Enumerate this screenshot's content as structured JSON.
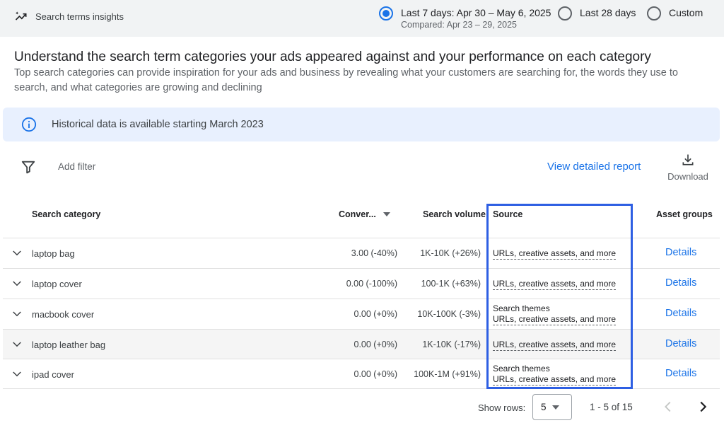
{
  "header": {
    "title": "Search terms insights",
    "icon": "trending-icon"
  },
  "date_range": {
    "options": [
      {
        "label": "Last 7 days: Apr 30 – May 6, 2025",
        "sub": "Compared: Apr 23 – 29, 2025",
        "selected": true
      },
      {
        "label": "Last 28 days",
        "selected": false
      },
      {
        "label": "Custom",
        "selected": false
      }
    ]
  },
  "intro": {
    "heading": "Understand the search term categories your ads appeared against and your performance on each category",
    "text": "Top search categories can provide inspiration for your ads and business by revealing what your customers are searching for, the words they use to search, and what categories are growing and declining"
  },
  "banner": {
    "text": "Historical data is available starting March 2023"
  },
  "toolbar": {
    "add_filter": "Add filter",
    "view_report": "View detailed report",
    "download": "Download"
  },
  "table": {
    "columns": {
      "category": "Search category",
      "conversions": "Conver...",
      "volume": "Search volume",
      "source": "Source",
      "asset_groups": "Asset groups"
    },
    "rows": [
      {
        "category": "laptop bag",
        "conversions": "3.00 (-40%)",
        "volume": "1K-10K (+26%)",
        "source_1": "",
        "source_2": "URLs, creative assets, and more",
        "details": "Details"
      },
      {
        "category": "laptop cover",
        "conversions": "0.00 (-100%)",
        "volume": "100-1K (+63%)",
        "source_1": "",
        "source_2": "URLs, creative assets, and more",
        "details": "Details"
      },
      {
        "category": "macbook cover",
        "conversions": "0.00 (+0%)",
        "volume": "10K-100K (-3%)",
        "source_1": "Search themes",
        "source_2": "URLs, creative assets, and more",
        "details": "Details"
      },
      {
        "category": "laptop leather bag",
        "conversions": "0.00 (+0%)",
        "volume": "1K-10K (-17%)",
        "source_1": "",
        "source_2": "URLs, creative assets, and more",
        "details": "Details"
      },
      {
        "category": "ipad cover",
        "conversions": "0.00 (+0%)",
        "volume": "100K-1M (+91%)",
        "source_1": "Search themes",
        "source_2": "URLs, creative assets, and more",
        "details": "Details"
      }
    ]
  },
  "pagination": {
    "show_rows_label": "Show rows:",
    "rows_value": "5",
    "range": "1 - 5 of 15"
  },
  "colors": {
    "accent": "#1a73e8",
    "highlight": "#2e5fe3",
    "banner_bg": "#e8f0fe"
  }
}
